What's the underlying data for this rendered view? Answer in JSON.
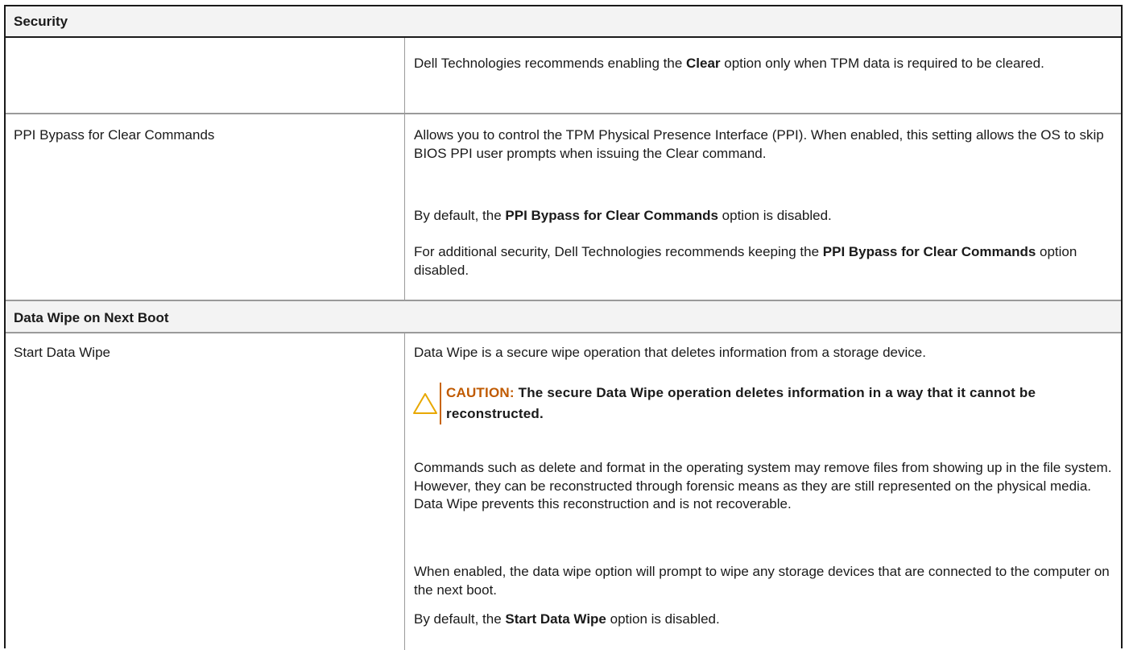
{
  "sections": [
    {
      "title": "Security",
      "rows": [
        {
          "name": "",
          "paragraphs": [
            [
              {
                "t": "Dell Technologies recommends enabling the "
              },
              {
                "t": "Clear",
                "b": true
              },
              {
                "t": " option only when TPM data is required to be cleared."
              }
            ]
          ]
        },
        {
          "name": "PPI Bypass for Clear Commands",
          "paragraphs": [
            [
              {
                "t": "Allows you to control the TPM Physical Presence Interface (PPI). When enabled, this setting allows the OS to skip BIOS PPI user prompts when issuing the Clear command."
              }
            ],
            [
              {
                "t": "By default, the "
              },
              {
                "t": "PPI Bypass for Clear Commands",
                "b": true
              },
              {
                "t": " option is disabled."
              }
            ],
            [
              {
                "t": "For additional security, Dell Technologies recommends keeping the "
              },
              {
                "t": "PPI Bypass for Clear Commands",
                "b": true
              },
              {
                "t": " option disabled."
              }
            ]
          ]
        }
      ]
    },
    {
      "title": "Data Wipe on Next Boot",
      "rows": [
        {
          "name": "Start Data Wipe",
          "intro": "Data Wipe is a secure wipe operation that deletes information from a storage device.",
          "caution_label": "CAUTION:",
          "caution_text": "The secure Data Wipe operation deletes information in a way that it cannot be reconstructed.",
          "paragraphs": [
            [
              {
                "t": "Commands such as delete and format in the operating system may remove files from showing up in the file system. However, they can be reconstructed through forensic means as they are still represented on the physical media. Data Wipe prevents this reconstruction and is not recoverable."
              }
            ],
            [
              {
                "t": "When enabled, the data wipe option will prompt to wipe any storage devices that are connected to the computer on the next boot."
              }
            ],
            [
              {
                "t": "By default, the "
              },
              {
                "t": "Start Data Wipe",
                "b": true
              },
              {
                "t": " option is disabled."
              }
            ]
          ]
        }
      ]
    }
  ],
  "icons": {
    "caution": "warning-triangle-icon"
  },
  "colors": {
    "caution_label": "#c05a00",
    "caution_bar": "#c86400",
    "caution_icon": "#e8a800"
  }
}
